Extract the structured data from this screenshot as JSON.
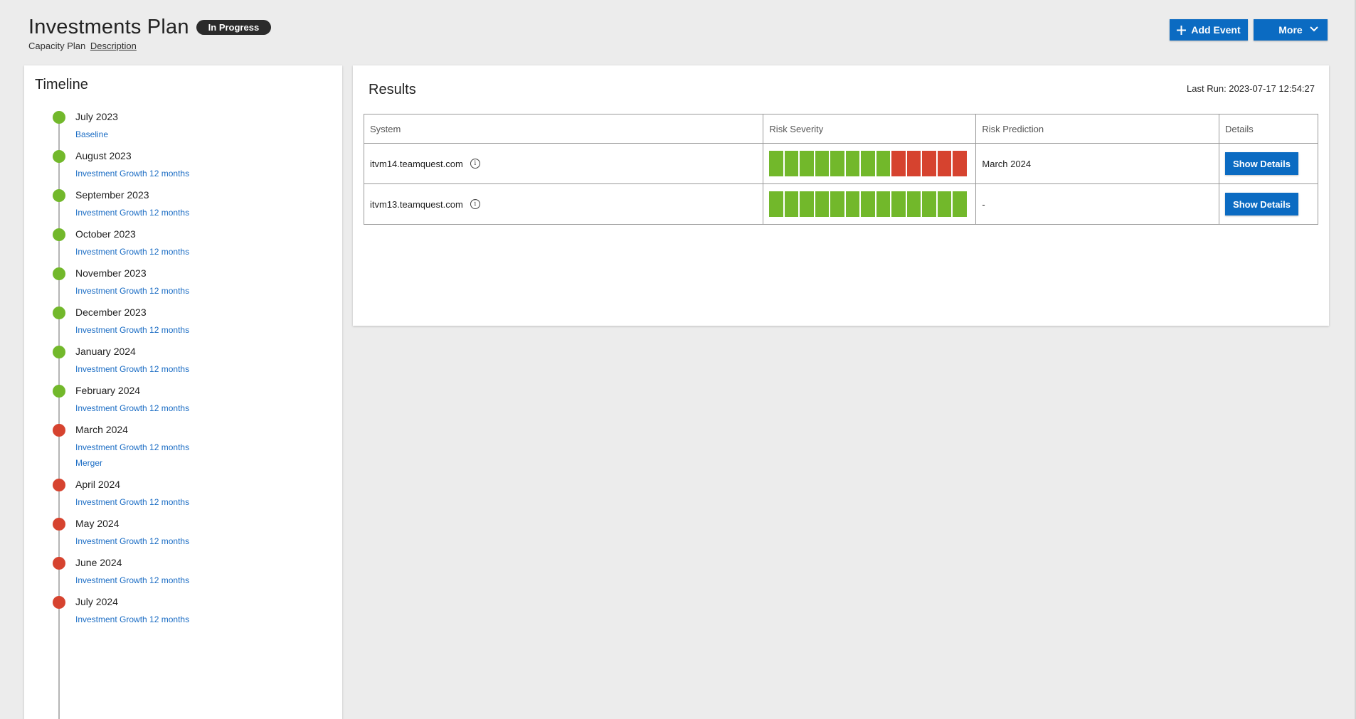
{
  "header": {
    "title": "Investments Plan",
    "status": "In Progress",
    "subtitle_prefix": "Capacity Plan",
    "description_link": "Description",
    "add_event_label": "Add Event",
    "more_label": "More"
  },
  "timeline": {
    "title": "Timeline",
    "items": [
      {
        "month": "July 2023",
        "status": "ok",
        "events": [
          "Baseline"
        ]
      },
      {
        "month": "August 2023",
        "status": "ok",
        "events": [
          "Investment Growth 12 months"
        ]
      },
      {
        "month": "September 2023",
        "status": "ok",
        "events": [
          "Investment Growth 12 months"
        ]
      },
      {
        "month": "October 2023",
        "status": "ok",
        "events": [
          "Investment Growth 12 months"
        ]
      },
      {
        "month": "November 2023",
        "status": "ok",
        "events": [
          "Investment Growth 12 months"
        ]
      },
      {
        "month": "December 2023",
        "status": "ok",
        "events": [
          "Investment Growth 12 months"
        ]
      },
      {
        "month": "January 2024",
        "status": "ok",
        "events": [
          "Investment Growth 12 months"
        ]
      },
      {
        "month": "February 2024",
        "status": "ok",
        "events": [
          "Investment Growth 12 months"
        ]
      },
      {
        "month": "March 2024",
        "status": "risk",
        "events": [
          "Investment Growth 12 months",
          "Merger"
        ]
      },
      {
        "month": "April 2024",
        "status": "risk",
        "events": [
          "Investment Growth 12 months"
        ]
      },
      {
        "month": "May 2024",
        "status": "risk",
        "events": [
          "Investment Growth 12 months"
        ]
      },
      {
        "month": "June 2024",
        "status": "risk",
        "events": [
          "Investment Growth 12 months"
        ]
      },
      {
        "month": "July 2024",
        "status": "risk",
        "events": [
          "Investment Growth 12 months"
        ]
      }
    ]
  },
  "results": {
    "title": "Results",
    "last_run": "Last Run: 2023-07-17 12:54:27",
    "columns": [
      "System",
      "Risk Severity",
      "Risk Prediction",
      "Details"
    ],
    "rows": [
      {
        "system": "itvm14.teamquest.com",
        "severity": [
          "ok",
          "ok",
          "ok",
          "ok",
          "ok",
          "ok",
          "ok",
          "ok",
          "risk",
          "risk",
          "risk",
          "risk",
          "risk"
        ],
        "prediction": "March 2024",
        "details_label": "Show Details"
      },
      {
        "system": "itvm13.teamquest.com",
        "severity": [
          "ok",
          "ok",
          "ok",
          "ok",
          "ok",
          "ok",
          "ok",
          "ok",
          "ok",
          "ok",
          "ok",
          "ok",
          "ok"
        ],
        "prediction": "-",
        "details_label": "Show Details"
      }
    ]
  },
  "colors": {
    "ok": "#72b82b",
    "risk": "#d6432f",
    "primary": "#0b6bc2",
    "link": "#1a6cc4"
  },
  "icons": {
    "add": "plus-icon",
    "more": "chevron-down-icon",
    "info": "info-icon"
  }
}
